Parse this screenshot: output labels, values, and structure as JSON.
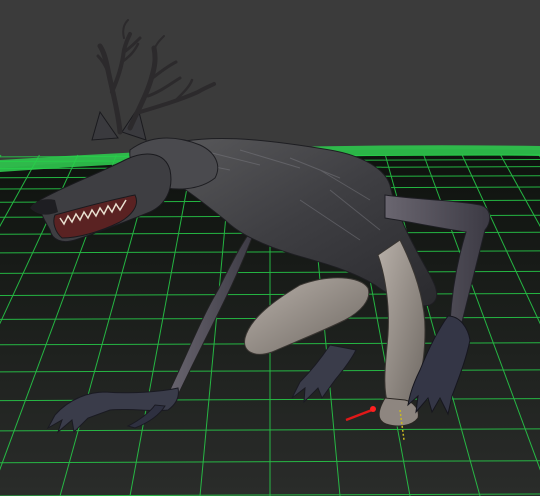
{
  "viewport": {
    "background_color": "#3a3a3a",
    "grid_color": "#27d04a",
    "floor_color": "#1d1f1d"
  },
  "scene": {
    "subject": "creature-model",
    "gizmo_color": "#e01818"
  }
}
